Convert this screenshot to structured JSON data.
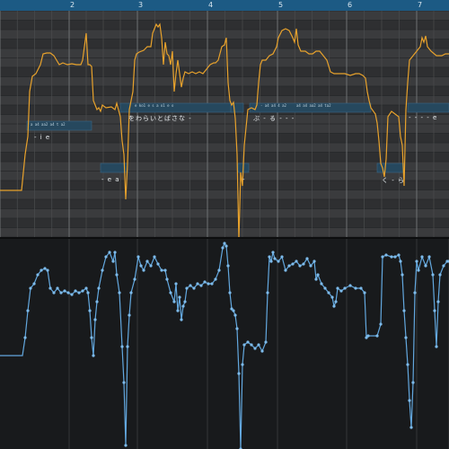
{
  "ruler": {
    "bars": [
      "2",
      "3",
      "4",
      "5",
      "6",
      "7"
    ]
  },
  "notes": [
    {
      "phonemes": "a a4 aa2 a4 t a2",
      "lyric": "- i e"
    },
    {
      "phonemes": "",
      "lyric": "- e a"
    },
    {
      "phonemes": "e ko1 e s a o1 e o",
      "lyric": "をわらいとばさな -"
    },
    {
      "phonemes": "",
      "lyric": "-"
    },
    {
      "phonemes": "- a4 a4 4 a2",
      "lyric": "ぶ - る - - -"
    },
    {
      "phonemes": "a4 a4 aa2 a4 ta2",
      "lyric": ""
    },
    {
      "phonemes": "",
      "lyric": "く - ら"
    },
    {
      "phonemes": "",
      "lyric": "- - - - e"
    }
  ],
  "colors": {
    "ruler": "#1c5a84",
    "pitch_curve": "#e8a22c",
    "note_block": "#26485e",
    "param_curve": "#63a8df"
  }
}
